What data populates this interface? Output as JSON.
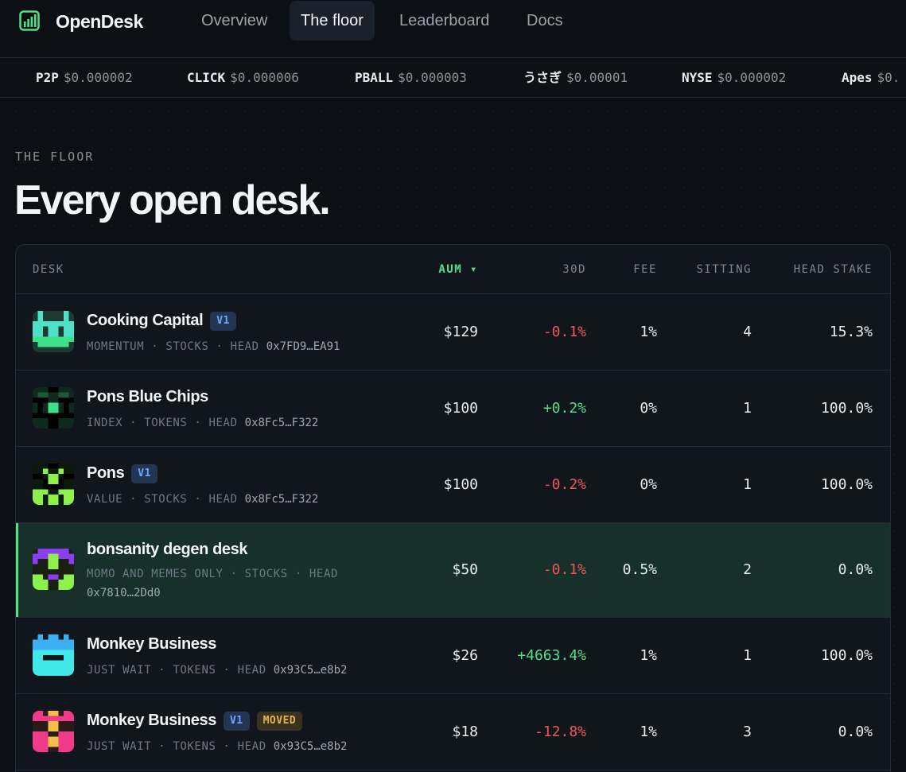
{
  "brand": {
    "name": "OpenDesk",
    "accent": "#4fe08a"
  },
  "nav": {
    "links": [
      {
        "label": "Overview"
      },
      {
        "label": "The floor",
        "active": true
      },
      {
        "label": "Leaderboard"
      },
      {
        "label": "Docs"
      }
    ]
  },
  "ticker": [
    {
      "symbol": "P2P",
      "price": "$0.000002"
    },
    {
      "symbol": "CLICK",
      "price": "$0.000006"
    },
    {
      "symbol": "PBALL",
      "price": "$0.000003"
    },
    {
      "symbol": "うさぎ",
      "price": "$0.00001"
    },
    {
      "symbol": "NYSE",
      "price": "$0.000002"
    },
    {
      "symbol": "Apes",
      "price": "$0."
    }
  ],
  "page": {
    "eyebrow": "THE FLOOR",
    "title": "Every open desk."
  },
  "table": {
    "headers": {
      "desk": "DESK",
      "aum": "AUM ▾",
      "d30": "30D",
      "fee": "FEE",
      "sitting": "SITTING",
      "head_stake": "HEAD STAKE"
    },
    "rows": [
      {
        "name": "Cooking Capital",
        "badges": [
          "V1"
        ],
        "meta": "MOMENTUM · STOCKS · HEAD",
        "addr": "0x7FD9…EA91",
        "aum": "$129",
        "d30": "-0.1%",
        "d30_sign": "neg",
        "fee": "1%",
        "sitting": "4",
        "head_stake": "15.3%",
        "avatar_icon": "pixel-avatar-cyan-green-icon"
      },
      {
        "name": "Pons Blue Chips",
        "badges": [],
        "meta": "INDEX · TOKENS · HEAD",
        "addr": "0x8Fc5…F322",
        "aum": "$100",
        "d30": "+0.2%",
        "d30_sign": "pos",
        "fee": "0%",
        "sitting": "1",
        "head_stake": "100.0%",
        "avatar_icon": "pixel-avatar-dark-green-icon"
      },
      {
        "name": "Pons",
        "badges": [
          "V1"
        ],
        "meta": "VALUE · STOCKS · HEAD",
        "addr": "0x8Fc5…F322",
        "aum": "$100",
        "d30": "-0.2%",
        "d30_sign": "neg",
        "fee": "0%",
        "sitting": "1",
        "head_stake": "100.0%",
        "avatar_icon": "pixel-avatar-lime-icon"
      },
      {
        "name": "bonsanity degen desk",
        "badges": [],
        "meta": "MOMO AND MEMES ONLY · STOCKS · HEAD",
        "addr": "0x7810…2Dd0",
        "aum": "$50",
        "d30": "-0.1%",
        "d30_sign": "neg",
        "fee": "0.5%",
        "sitting": "2",
        "head_stake": "0.0%",
        "avatar_icon": "pixel-avatar-purple-lime-icon",
        "highlight": true
      },
      {
        "name": "Monkey Business",
        "badges": [],
        "meta": "JUST WAIT · TOKENS · HEAD",
        "addr": "0x93C5…e8b2",
        "aum": "$26",
        "d30": "+4663.4%",
        "d30_sign": "pos",
        "fee": "1%",
        "sitting": "1",
        "head_stake": "100.0%",
        "avatar_icon": "pixel-avatar-cyan-blue-icon"
      },
      {
        "name": "Monkey Business",
        "badges": [
          "V1",
          "MOVED"
        ],
        "meta": "JUST WAIT · TOKENS · HEAD",
        "addr": "0x93C5…e8b2",
        "aum": "$18",
        "d30": "-12.8%",
        "d30_sign": "neg",
        "fee": "1%",
        "sitting": "3",
        "head_stake": "0.0%",
        "avatar_icon": "pixel-avatar-pink-yellow-icon"
      }
    ]
  }
}
